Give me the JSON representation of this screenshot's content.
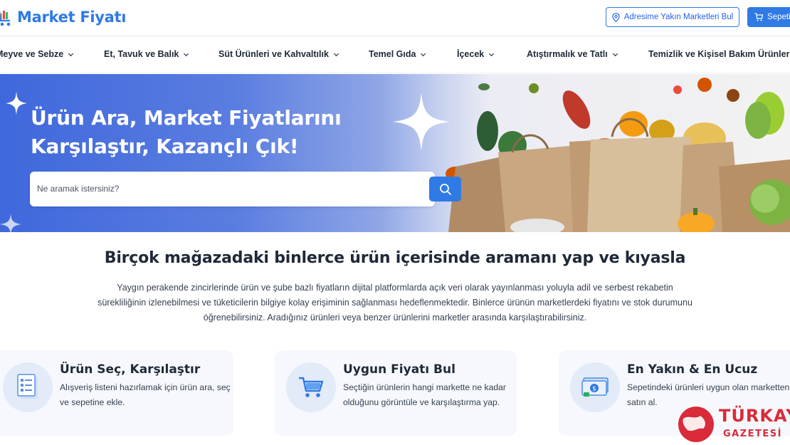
{
  "header": {
    "logo_text": "Market Fiyatı",
    "address_button": "Adresime Yakın Marketleri Bul",
    "cart_button": "Sepeti"
  },
  "nav": {
    "items": [
      {
        "label": "Meyve ve Sebze"
      },
      {
        "label": "Et, Tavuk ve Balık"
      },
      {
        "label": "Süt Ürünleri ve Kahvaltılık"
      },
      {
        "label": "Temel Gıda"
      },
      {
        "label": "İçecek"
      },
      {
        "label": "Atıştırmalık ve Tatlı"
      },
      {
        "label": "Temizlik ve Kişisel Bakım Ürünleri"
      }
    ]
  },
  "hero": {
    "title_line1": "Ürün Ara, Market Fiyatlarını",
    "title_line2": "Karşılaştır, Kazançlı Çık!",
    "search_placeholder": "Ne aramak istersiniz?"
  },
  "intro": {
    "title": "Birçok mağazadaki binlerce ürün içerisinde aramanı yap ve kıyasla",
    "line1": "Yaygın perakende zincirlerinde ürün ve şube bazlı fiyatların dijital platformlarda açık veri olarak yayınlanması yoluyla adil ve serbest rekabetin",
    "line2": "sürekliliğinin izlenebilmesi ve tüketicilerin bilgiye kolay erişiminin sağlanması hedeflenmektedir. Binlerce ürünün marketlerdeki fiyatını ve stok durumunu",
    "line3": "öğrenebilirsiniz. Aradığınız ürünleri veya benzer ürünlerini marketler arasında karşılaştırabilirsiniz."
  },
  "features": [
    {
      "title": "Ürün Seç, Karşılaştır",
      "desc": "Alışveriş listeni hazırlamak için ürün ara, seç ve sepetine ekle.",
      "icon": "list-icon"
    },
    {
      "title": "Uygun Fiyatı Bul",
      "desc": "Seçtiğin ürünlerin hangi markette ne kadar olduğunu görüntüle ve karşılaştırma yap.",
      "icon": "cart-icon"
    },
    {
      "title": "En Yakın & En Ucuz",
      "desc": "Sepetindeki ürünleri uygun olan marketten satın al.",
      "icon": "money-icon"
    }
  ],
  "watermark": {
    "line1": "TÜRKAY",
    "line2": "GAZETESİ"
  },
  "colors": {
    "brand": "#2f7ae5",
    "hero_start": "#3f68dc",
    "watermark": "#d92b3a"
  }
}
